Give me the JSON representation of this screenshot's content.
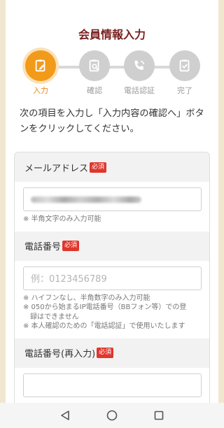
{
  "page": {
    "title": "会員情報入力",
    "instructions": "次の項目を入力し「入力内容の確認へ」ボタンをクリックしてください。"
  },
  "steps": [
    {
      "label": "入力",
      "icon": "form-edit-icon",
      "active": true
    },
    {
      "label": "確認",
      "icon": "document-search-icon",
      "active": false
    },
    {
      "label": "電話認証",
      "icon": "phone-call-icon",
      "active": false
    },
    {
      "label": "完了",
      "icon": "clipboard-check-icon",
      "active": false
    }
  ],
  "form": {
    "email": {
      "label": "メールアドレス",
      "required": "必須",
      "notes": [
        "※ 半角文字のみ入力可能"
      ]
    },
    "phone": {
      "label": "電話番号",
      "required": "必須",
      "placeholder": "例：0123456789",
      "notes": [
        "※ ハイフンなし、半角数字のみ入力可能",
        "※ 050から始まるIP電話番号（BBフォン等）での登",
        "　録はできません",
        "※ 本人確認のための「電話認証」で使用いたします"
      ]
    },
    "phone_confirm": {
      "label": "電話番号(再入力)",
      "required": "必須",
      "value": ""
    }
  },
  "colors": {
    "background": "#f1e6cf",
    "title": "#7a1f1f",
    "active_step": "#f29a1a",
    "inactive_step": "#cfcfcf",
    "required_badge": "#e0362c"
  },
  "navbar": {
    "back": "back-triangle-icon",
    "home": "home-circle-icon",
    "recents": "recents-square-icon"
  }
}
